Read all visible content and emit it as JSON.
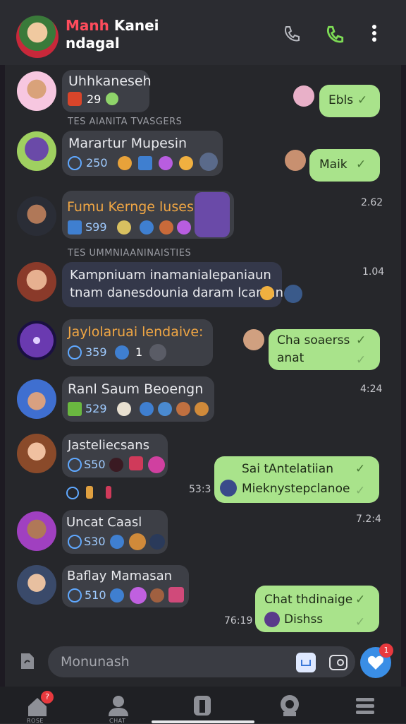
{
  "header": {
    "title_part1": "Manh",
    "title_part2": " Kanei",
    "title_line2": "ndagal",
    "icons": [
      "call-voice-icon",
      "call-icon",
      "more-vert-icon"
    ]
  },
  "sections": [
    "TES AIANITA TVASGERS",
    "TES UMMNIAANINAISTIES"
  ],
  "incoming": [
    {
      "name": "Uhhkaneseh",
      "stat": "29"
    },
    {
      "name": "Marartur Mupesin",
      "stat": "250"
    },
    {
      "name": "Fumu Kernge luses",
      "stat": "S99"
    },
    {
      "name_line1": "Kampniuam inamanialepaniaun",
      "name_line2": "tnam danesdounia daram lcanian"
    },
    {
      "name": "Jaylolaruai lendaive:",
      "stat": "359",
      "stat2": "1"
    },
    {
      "name": "Ranl Saum Beoengn",
      "stat": "529"
    },
    {
      "name": "Jasteliecsans",
      "stat": "S50"
    },
    {
      "name": "Uncat Caasl",
      "stat": "S30"
    },
    {
      "name": "Baflay Mamasan",
      "stat": "510"
    }
  ],
  "outgoing": [
    {
      "text": "Ebls"
    },
    {
      "text": "Maik"
    },
    {
      "line1": "Cha soaerss",
      "line2": "anat"
    },
    {
      "line1": "Sai tAntelatiian",
      "line2": "Mieknystepclanoe"
    },
    {
      "line1": "Chat thdinaige",
      "line2": "Dishss"
    }
  ],
  "times": [
    "2.62",
    "1.04",
    "4:24",
    "53:3",
    "7.2:4",
    "76:19"
  ],
  "composer": {
    "placeholder": "Monunash"
  },
  "send_badge": "1",
  "nav_badge": "?",
  "nav_labels": [
    "ROSE",
    "CHAT"
  ],
  "colors": {
    "accent_green": "#a9e38b",
    "brand_red": "#ff4c5c",
    "send_blue": "#3a8ee6"
  }
}
